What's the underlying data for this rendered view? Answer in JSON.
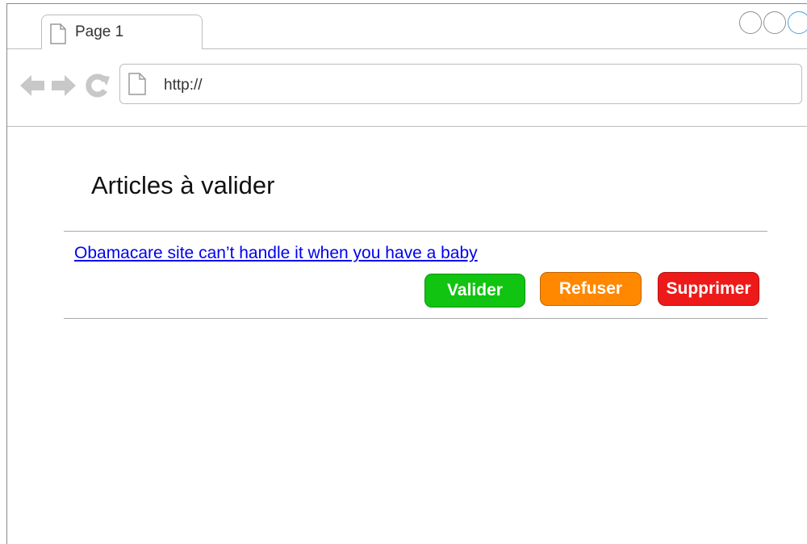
{
  "browser": {
    "tab_label": "Page 1",
    "url": "http://"
  },
  "page": {
    "title": "Articles à valider",
    "article_link": "Obamacare site can’t handle it when you have a baby"
  },
  "actions": {
    "validate_label": "Valider",
    "refuse_label": "Refuser",
    "delete_label": "Supprimer"
  },
  "colors": {
    "validate": "#11c411",
    "refuse": "#ff8800",
    "delete": "#ee1a1a",
    "link": "#0000ee"
  },
  "icons": [
    "page-icon",
    "back-arrow-icon",
    "forward-arrow-icon",
    "reload-icon"
  ]
}
